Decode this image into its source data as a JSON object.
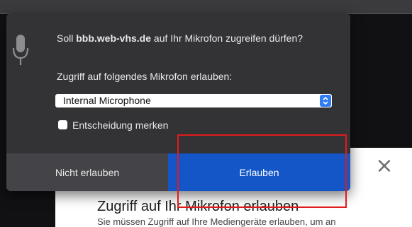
{
  "permission_prompt": {
    "question_prefix": "Soll ",
    "domain": "bbb.web-vhs.de",
    "question_suffix": " auf Ihr Mikrofon zugreifen dürfen?",
    "microphone_label": "Zugriff auf folgendes Mikrofon erlauben:",
    "microphone_select_value": "Internal Microphone",
    "remember_checkbox_label": "Entscheidung merken",
    "remember_checked": false,
    "deny_label": "Nicht erlauben",
    "allow_label": "Erlauben",
    "mic_icon": "microphone-icon",
    "allow_color": "#1456c8"
  },
  "background_dialog": {
    "title": "Zugriff auf Ihr Mikrofon erlauben",
    "text": "Sie müssen Zugriff auf Ihre Mediengeräte erlauben, um an",
    "close_symbol": "×",
    "close_icon": "close-icon"
  },
  "annotation": {
    "highlight_color": "#e01b1b",
    "highlight_target": "allow-button"
  }
}
